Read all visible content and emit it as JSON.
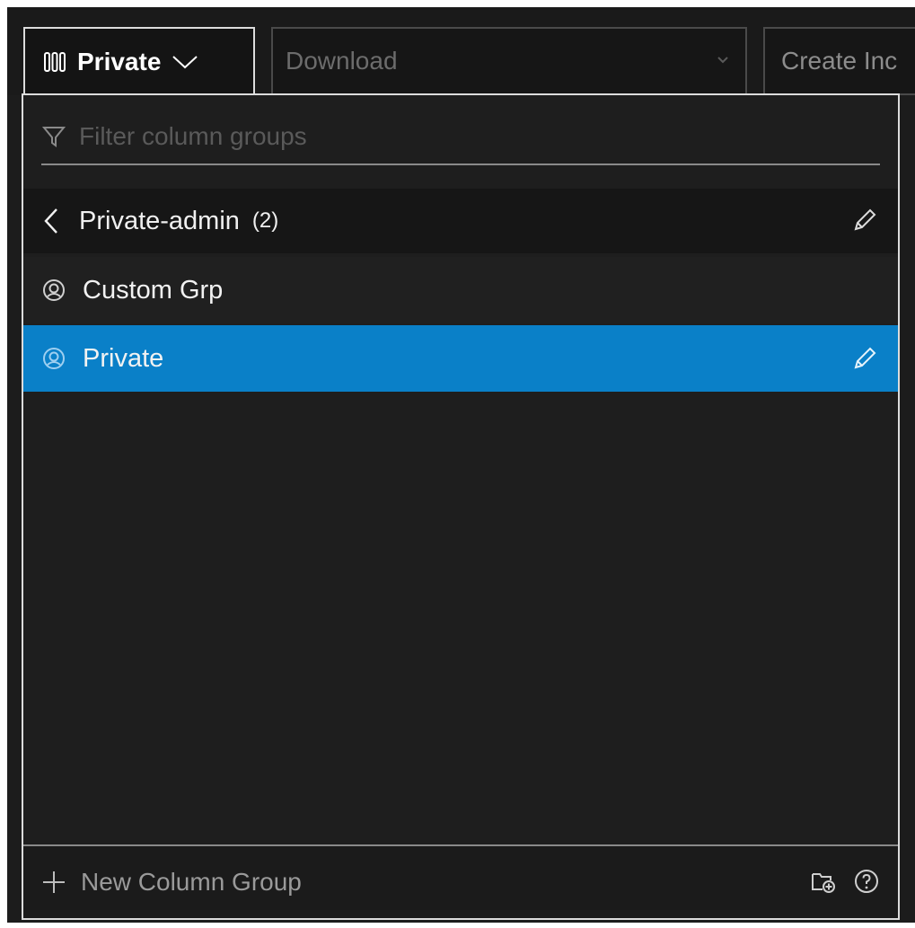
{
  "toolbar": {
    "column_group_button_label": "Private",
    "download_label": "Download",
    "create_label": "Create Inc"
  },
  "panel": {
    "filter_placeholder": "Filter column groups",
    "group_header": {
      "name": "Private-admin",
      "count": "(2)"
    },
    "items": [
      {
        "label": "Custom Grp",
        "selected": false
      },
      {
        "label": "Private",
        "selected": true
      }
    ],
    "footer": {
      "new_group_label": "New Column Group"
    }
  },
  "colors": {
    "selected_row": "#0a80c8",
    "background": "#1c1c1c",
    "border": "#dcdcdc"
  },
  "icons": [
    "columns-icon",
    "chevron-down-icon",
    "filter-icon",
    "chevron-left-icon",
    "edit-pencil-icon",
    "user-circle-icon",
    "plus-icon",
    "add-folder-icon",
    "help-icon"
  ]
}
